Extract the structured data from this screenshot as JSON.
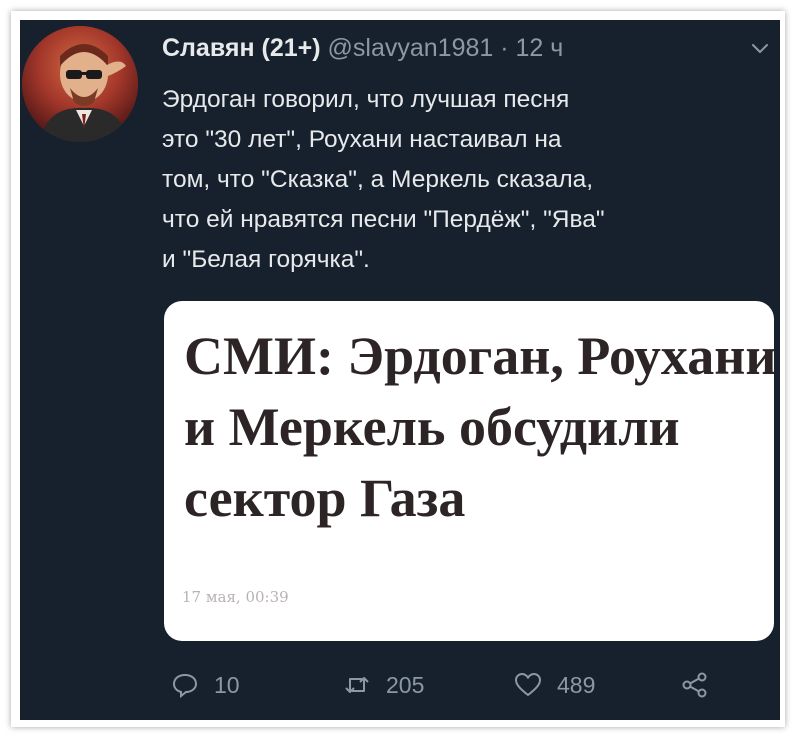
{
  "tweet": {
    "display_name": "Славян (21+)",
    "handle": "@slavyan1981",
    "separator": "·",
    "time_ago": "12 ч",
    "text_lines": [
      "Эрдоган говорил, что лучшая песня",
      "это \"30 лет\", Роухани настаивал на",
      "том, что \"Сказка\", а Меркель сказала,",
      "что ей нравятся песни \"Пердёж\", \"Ява\"",
      "и \"Белая горячка\"."
    ]
  },
  "card": {
    "headline_lines": [
      "СМИ: Эрдоган, Роухани",
      "и Меркель обсудили",
      "сектор Газа"
    ],
    "date": "17 мая, 00:39"
  },
  "actions": {
    "reply_count": "10",
    "retweet_count": "205",
    "like_count": "489"
  },
  "icons": {
    "reply": "reply-icon",
    "retweet": "retweet-icon",
    "like": "heart-icon",
    "share": "share-icon",
    "menu": "chevron-down-icon"
  },
  "colors": {
    "background": "#16212d",
    "primary_text": "#e7e9ea",
    "secondary_text": "#8b98a5",
    "card_background": "#ffffff",
    "headline_text": "#2d2426"
  }
}
